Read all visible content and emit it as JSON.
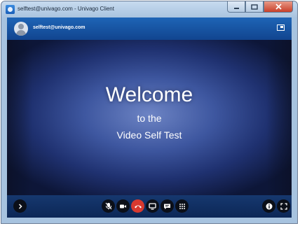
{
  "window": {
    "title": "selftest@univago.com - Univago Client"
  },
  "header": {
    "user_email": "selftest@univago.com"
  },
  "video": {
    "welcome": "Welcome",
    "line1": "to the",
    "line2": "Video Self Test"
  },
  "colors": {
    "accent": "#1e65b6",
    "end_call": "#d8392f",
    "control_bg": "#0b0f18"
  },
  "toolbar": {
    "icons": [
      "expand-icon",
      "mute-mic-icon",
      "camera-icon",
      "end-call-icon",
      "screen-share-icon",
      "chat-icon",
      "keypad-icon",
      "info-icon",
      "fullscreen-icon"
    ]
  }
}
